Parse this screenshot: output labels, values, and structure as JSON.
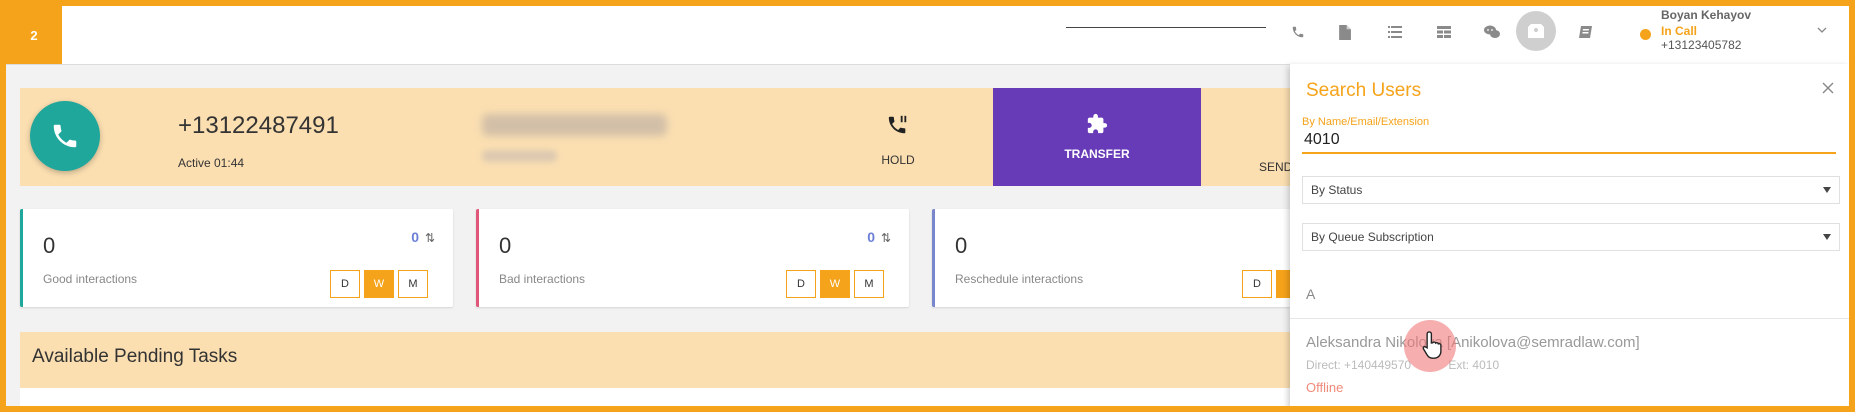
{
  "topbar": {
    "badge": "2",
    "icons": [
      "phone-icon",
      "document-icon",
      "list-icon",
      "table-icon",
      "chat-icon",
      "user-card-icon",
      "book-icon"
    ],
    "user": {
      "name": "Boyan Kehayov",
      "status": "In Call",
      "phone": "+13123405782"
    }
  },
  "call": {
    "number": "+13122487491",
    "active_label": "Active 01:44",
    "hold_label": "HOLD",
    "transfer_label": "TRANSFER",
    "send_label": "SEND"
  },
  "cards": [
    {
      "value": "0",
      "label": "Good interactions",
      "count": "0",
      "accent": "#1fa79b",
      "periods": [
        "D",
        "W",
        "M"
      ],
      "active_period": "W"
    },
    {
      "value": "0",
      "label": "Bad interactions",
      "count": "0",
      "accent": "#e0577a",
      "periods": [
        "D",
        "W",
        "M"
      ],
      "active_period": "W"
    },
    {
      "value": "0",
      "label": "Reschedule interactions",
      "count": "",
      "accent": "#7986cb",
      "periods": [
        "D"
      ],
      "active_period": "W"
    }
  ],
  "tasks": {
    "title": "Available Pending Tasks"
  },
  "search_panel": {
    "title": "Search Users",
    "field_label": "By Name/Email/Extension",
    "query": "4010",
    "status_select": "By Status",
    "queue_select": "By Queue Subscription",
    "group_letter": "A",
    "result": {
      "name": "Aleksandra Nikolova [Anikolova@semradlaw.com]",
      "direct": "Direct: +140449570",
      "ext": "Ext: 4010",
      "status": "Offline"
    }
  },
  "colors": {
    "accent": "#f5a31a",
    "transfer": "#673ab7",
    "call_button": "#1fa79b",
    "offline": "#f08a7a"
  }
}
